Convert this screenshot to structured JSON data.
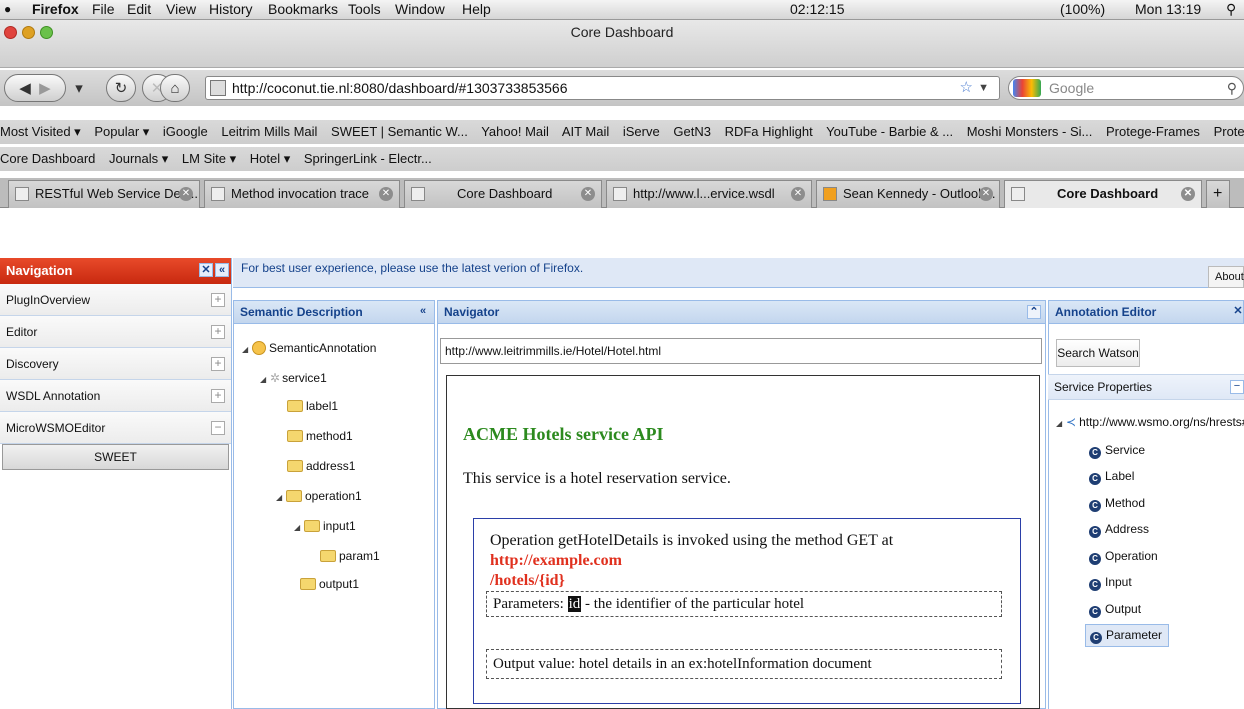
{
  "menubar": {
    "app": "Firefox",
    "items": [
      "File",
      "Edit",
      "View",
      "History",
      "Bookmarks",
      "Tools",
      "Window",
      "Help"
    ],
    "clock_time": "02:12:15",
    "battery": "(100%)",
    "datetime": "Mon 13:19"
  },
  "window": {
    "title": "Core Dashboard"
  },
  "toolbar": {
    "url": "http://coconut.tie.nl:8080/dashboard/#1303733853566",
    "search_placeholder": "Google"
  },
  "bookmarks": {
    "row1": [
      "Most Visited ▾",
      "Popular ▾",
      "iGoogle",
      "Leitrim Mills Mail",
      "SWEET | Semantic W...",
      "Yahoo! Mail",
      "AIT Mail",
      "iServe",
      "GetN3",
      "RDFa Highlight",
      "YouTube - Barbie & ...",
      "Moshi Monsters - Si...",
      "Protege-Frames",
      "Protege OWL tutorial..."
    ],
    "row2": [
      "Core Dashboard",
      "Journals ▾",
      "LM Site ▾",
      "Hotel ▾",
      "SpringerLink - Electr..."
    ]
  },
  "tabs": [
    {
      "label": "RESTful Web Service Des..."
    },
    {
      "label": "Method invocation trace"
    },
    {
      "label": "Core Dashboard"
    },
    {
      "label": "http://www.l...ervice.wsdl"
    },
    {
      "label": "Sean Kennedy - Outlook..."
    },
    {
      "label": "Core Dashboard"
    }
  ],
  "infobar": {
    "message": "For best user experience, please use the latest verion of Firefox.",
    "about": "About"
  },
  "navigation": {
    "title": "Navigation",
    "items": [
      {
        "label": "PlugInOverview"
      },
      {
        "label": "Editor"
      },
      {
        "label": "Discovery"
      },
      {
        "label": "WSDL Annotation"
      },
      {
        "label": "MicroWSMOEditor"
      }
    ],
    "sweet_button": "SWEET"
  },
  "semantic_description": {
    "title": "Semantic Description",
    "tree": [
      "SemanticAnnotation",
      "service1",
      "label1",
      "method1",
      "address1",
      "operation1",
      "input1",
      "param1",
      "output1"
    ]
  },
  "navigator": {
    "title": "Navigator",
    "url": "http://www.leitrimmills.ie/Hotel/Hotel.html",
    "page": {
      "heading": "ACME Hotels service API",
      "intro": "This service is a hotel reservation service.",
      "op_text": "Operation getHotelDetails is invoked using the method GET at ",
      "op_link_1": "http://example.com",
      "op_link_2": "/hotels/{id}",
      "params_prefix": "Parameters: ",
      "params_id": "id",
      "params_suffix": " - the identifier of the particular hotel",
      "output": "Output value: hotel details in an ex:hotelInformation document"
    }
  },
  "annotation_editor": {
    "title": "Annotation Editor",
    "search_button": "Search Watson",
    "service_properties": "Service Properties",
    "namespace": "http://www.wsmo.org/ns/hrests#",
    "classes": [
      "Service",
      "Label",
      "Method",
      "Address",
      "Operation",
      "Input",
      "Output",
      "Parameter"
    ],
    "selected": "Parameter"
  },
  "colors": {
    "nav_header": "#d33a1c",
    "panel_header_text": "#15428b",
    "heading_green": "#2c8a1e",
    "link_red": "#e0301e"
  }
}
